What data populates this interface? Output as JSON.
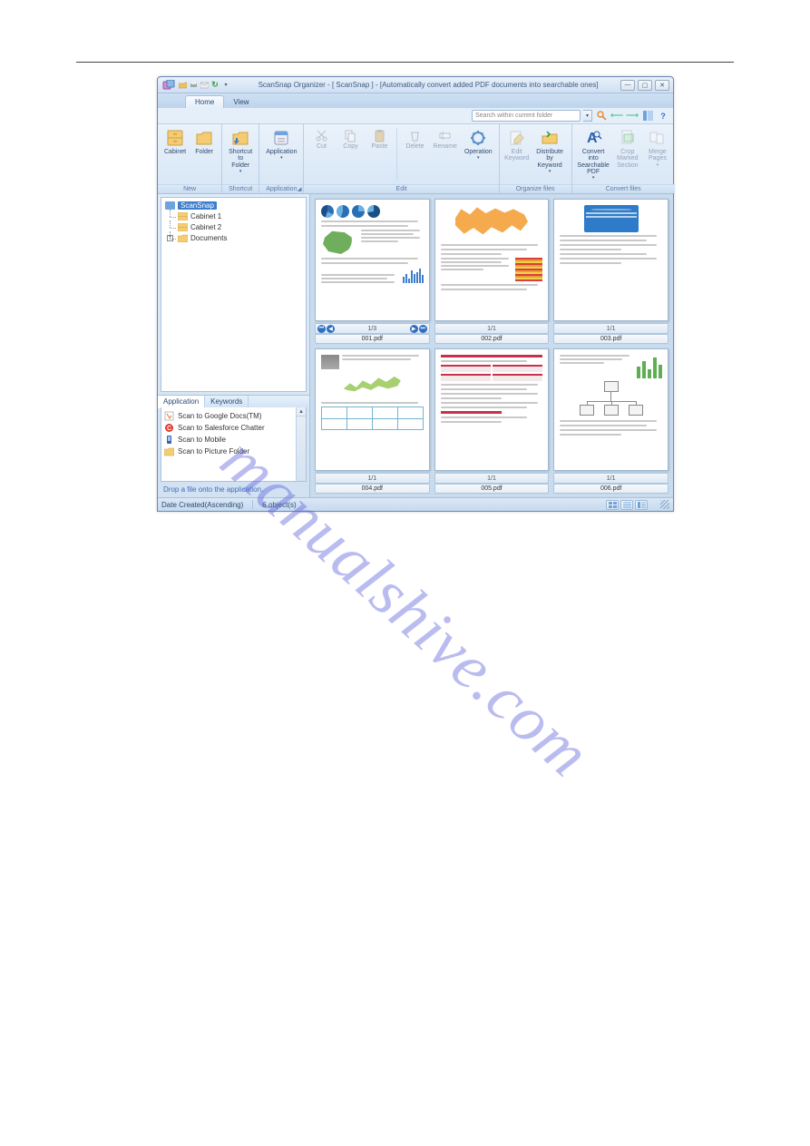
{
  "watermark": "manualshive.com",
  "window": {
    "title": "ScanSnap Organizer - [ ScanSnap ]  -  [Automatically convert added PDF documents into searchable ones]",
    "controls": {
      "min": "—",
      "max": "▢",
      "close": "✕"
    }
  },
  "tabs": {
    "home": "Home",
    "view": "View"
  },
  "search": {
    "placeholder": "Search within current folder"
  },
  "ribbon": {
    "new": {
      "label": "New",
      "cabinet": "Cabinet",
      "folder": "Folder"
    },
    "shortcut": {
      "label": "Shortcut",
      "btn": "Shortcut\nto Folder"
    },
    "application": {
      "label": "Application",
      "btn": "Application"
    },
    "edit": {
      "label": "Edit",
      "cut": "Cut",
      "copy": "Copy",
      "paste": "Paste",
      "delete": "Delete",
      "rename": "Rename",
      "operation": "Operation"
    },
    "organize": {
      "label": "Organize files",
      "editkw": "Edit\nKeyword",
      "distribute": "Distribute by\nKeyword"
    },
    "convert": {
      "label": "Convert files",
      "convert": "Convert into\nSearchable PDF",
      "crop": "Crop Marked\nSection",
      "merge": "Merge\nPages"
    }
  },
  "tree": {
    "root": "ScanSnap",
    "children": [
      "Cabinet 1",
      "Cabinet 2",
      "Documents"
    ]
  },
  "apps": {
    "tab1": "Application",
    "tab2": "Keywords",
    "items": [
      "Scan to Google Docs(TM)",
      "Scan to Salesforce Chatter",
      "Scan to Mobile",
      "Scan to Picture Folder"
    ],
    "hint": "Drop a file onto the application."
  },
  "thumbs": [
    {
      "pages": "1/3",
      "file": "001.pdf",
      "nav": true
    },
    {
      "pages": "1/1",
      "file": "002.pdf",
      "nav": false
    },
    {
      "pages": "1/1",
      "file": "003.pdf",
      "nav": false
    },
    {
      "pages": "1/1",
      "file": "004.pdf",
      "nav": false
    },
    {
      "pages": "1/1",
      "file": "005.pdf",
      "nav": false
    },
    {
      "pages": "1/1",
      "file": "006.pdf",
      "nav": false
    }
  ],
  "status": {
    "sort": "Date Created(Ascending)",
    "count": "6 object(s)"
  }
}
